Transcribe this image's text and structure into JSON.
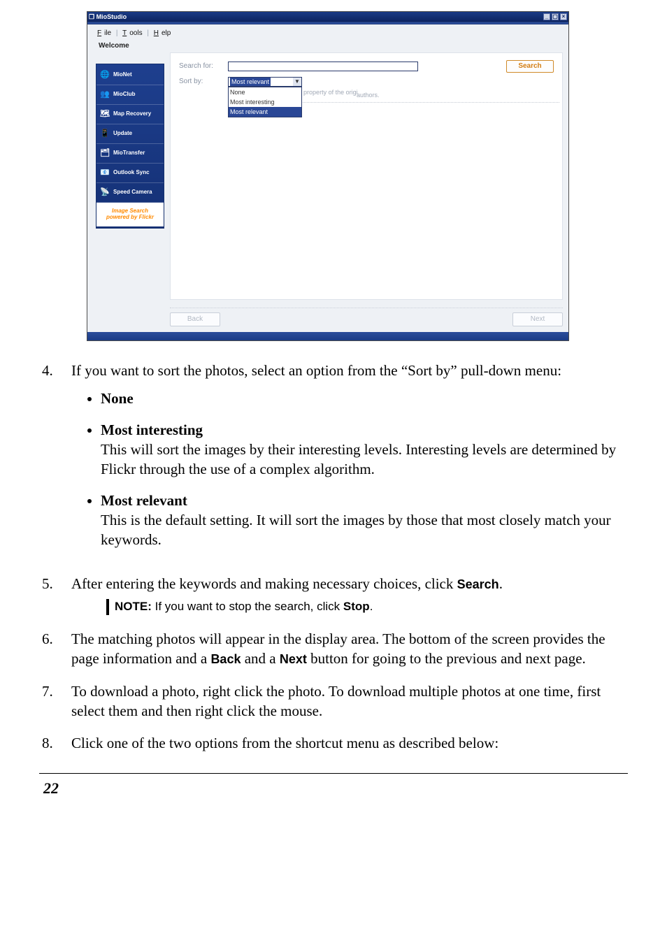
{
  "window": {
    "title": "MioStudio",
    "title_prefix_icon": "app-icon"
  },
  "menu": {
    "file": "File",
    "tools": "Tools",
    "help": "Help",
    "sep": "|"
  },
  "welcome": "Welcome",
  "sidebar": [
    {
      "icon": "🌐",
      "label": "MioNet"
    },
    {
      "icon": "👥",
      "label": "MioClub"
    },
    {
      "icon": "🗺",
      "label": "Map Recovery"
    },
    {
      "icon": "📱",
      "label": "Update"
    },
    {
      "icon": "🗂",
      "label": "MioTransfer"
    },
    {
      "icon": "📧",
      "label": "Outlook Sync"
    },
    {
      "icon": "📡",
      "label": "Speed Camera"
    }
  ],
  "sidebar_selected": {
    "line1": "Image Search",
    "line2": "powered by Flickr"
  },
  "panel": {
    "search_for_label": "Search for:",
    "search_for_value": "",
    "sort_by_label": "Sort by:",
    "sort_selected": "Most relevant",
    "sort_options": [
      "None",
      "Most interesting",
      "Most relevant"
    ],
    "subtext_prefix": "All images remain the sole property of the origi",
    "authors": "authors.",
    "search_button": "Search",
    "back_button": "Back",
    "next_button": "Next"
  },
  "doc": {
    "step4_num": "4.",
    "step4": "If you want to sort the photos, select an option from the “Sort by” pull-down menu:",
    "b_none": "None",
    "b_mi_title": "Most interesting",
    "b_mi_desc": "This will sort the images by their interesting levels. Interesting levels are determined by Flickr through the use of a complex algorithm.",
    "b_mr_title": "Most relevant",
    "b_mr_desc": "This is the default setting. It will sort the images by those that most closely match your keywords.",
    "step5_num": "5.",
    "step5_a": "After entering the keywords and making necessary choices, click ",
    "step5_b": "Search",
    "step5_c": ".",
    "note_label": "NOTE:",
    "note_a": " If you want to stop the search, click ",
    "note_b": "Stop",
    "note_c": ".",
    "step6_num": "6.",
    "step6_a": "The matching photos will appear in the display area. The bottom of the screen provides the page information and a ",
    "step6_b": "Back",
    "step6_c": " and a ",
    "step6_d": "Next",
    "step6_e": " button for going to the previous and next page.",
    "step7_num": "7.",
    "step7": "To download a photo, right click the photo. To download multiple photos at one time, first select them and then right click the mouse.",
    "step8_num": "8.",
    "step8": "Click one of the two options from the shortcut menu as described below:",
    "page_number": "22"
  }
}
